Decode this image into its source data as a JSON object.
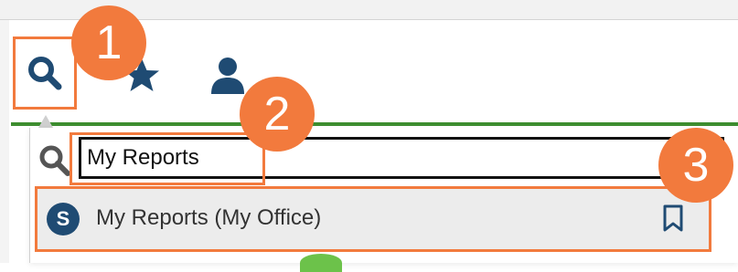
{
  "toolbar": {
    "search_icon": "search-icon",
    "favorites_icon": "star-icon",
    "profile_icon": "person-icon"
  },
  "search": {
    "value": "My Reports",
    "icon": "search-icon"
  },
  "results": [
    {
      "avatar_letter": "S",
      "label": "My Reports (My Office)",
      "action_icon": "bookmark-icon"
    }
  ],
  "callouts": [
    "1",
    "2",
    "3"
  ],
  "colors": {
    "callout": "#f27a3d",
    "icon": "#1f4b73",
    "accent_line": "#3d8d2f",
    "row_bg": "#ececec"
  }
}
